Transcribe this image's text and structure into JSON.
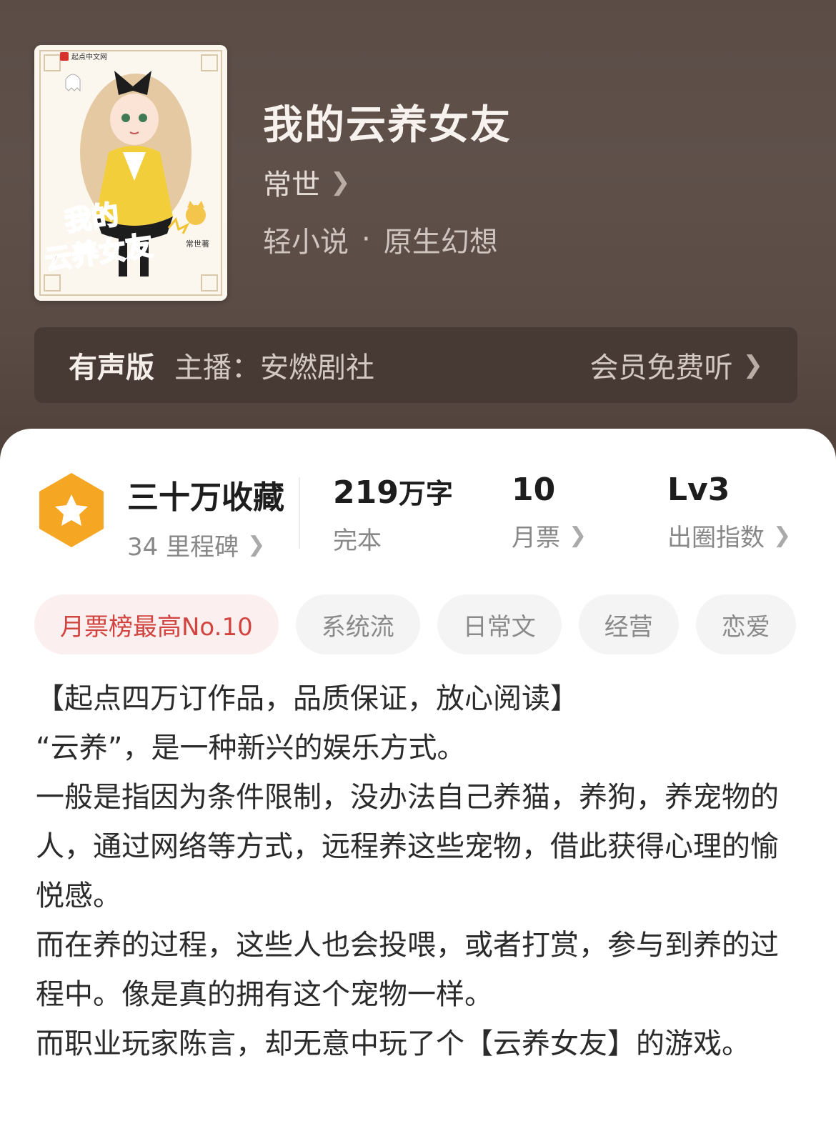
{
  "header": {
    "title": "我的云养女友",
    "author": "常世",
    "genre": "轻小说",
    "separator": "·",
    "subgenre": "原生幻想",
    "cover": {
      "publisher": "起点中文网",
      "title_line1": "我的",
      "title_line2": "云养女友",
      "author_stamp": "常世著"
    }
  },
  "audio": {
    "tag": "有声版",
    "host": "主播：安燃剧社",
    "cta": "会员免费听"
  },
  "stats": {
    "favorites": {
      "value": "三十万收藏",
      "label": "34 里程碑"
    },
    "words": {
      "number": "219",
      "unit": "万字",
      "label": "完本"
    },
    "tickets": {
      "value": "10",
      "label": "月票"
    },
    "level": {
      "value": "Lv3",
      "label": "出圈指数"
    }
  },
  "tags": [
    "月票榜最高No.10",
    "系统流",
    "日常文",
    "经营",
    "恋爱"
  ],
  "description": [
    "【起点四万订作品，品质保证，放心阅读】",
    "“云养”，是一种新兴的娱乐方式。",
    "一般是指因为条件限制，没办法自己养猫，养狗，养宠物的人，通过网络等方式，远程养这些宠物，借此获得心理的愉悦感。",
    "而在养的过程，这些人也会投喂，或者打赏，参与到养的过程中。像是真的拥有这个宠物一样。",
    "而职业玩家陈言，却无意中玩了个【云养女友】的游戏。"
  ],
  "colors": {
    "header_bg": "#5b4d46",
    "audio_bar_bg": "#473a34",
    "badge_orange": "#f5a623",
    "rank_chip_text": "#d1443f",
    "rank_chip_bg": "#fbf0ef"
  },
  "icons": [
    "chevron-right-icon",
    "star-badge-icon"
  ]
}
